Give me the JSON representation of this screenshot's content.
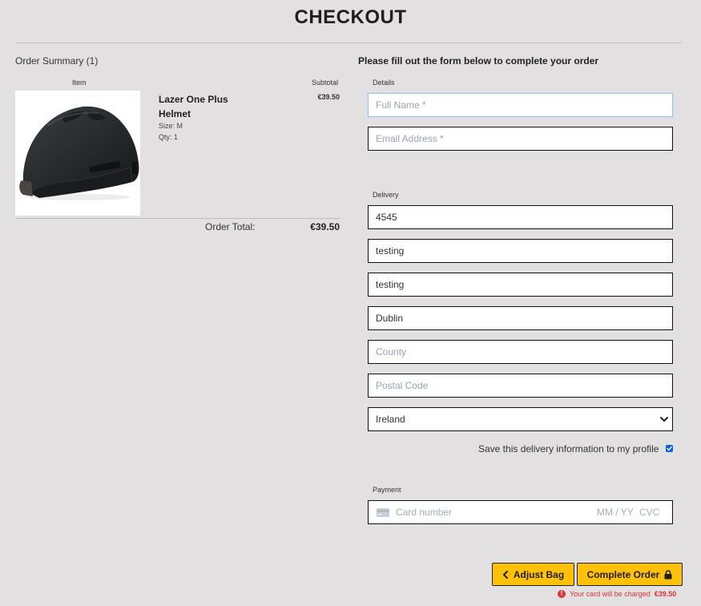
{
  "page": {
    "title": "CHECKOUT"
  },
  "summary": {
    "heading": "Order Summary (1)",
    "col_item": "Item",
    "col_subtotal": "Subtotal",
    "product": {
      "name": "Lazer One Plus Helmet",
      "size": "Size: M",
      "qty": "Qty: 1",
      "subtotal": "€39.50"
    },
    "total_label": "Order Total:",
    "total_value": "€39.50"
  },
  "form": {
    "heading": "Please fill out the form below to complete your order",
    "details_legend": "Details",
    "full_name_placeholder": "Full Name *",
    "email_placeholder": "Email Address *",
    "delivery_legend": "Delivery",
    "phone_value": "4545",
    "street1_value": "testing",
    "street2_value": "testing",
    "town_value": "Dublin",
    "county_placeholder": "County",
    "postcode_placeholder": "Postal Code",
    "country_selected": "Ireland",
    "save_info_label": "Save this delivery information to my profile",
    "save_info_checked": true,
    "payment_legend": "Payment",
    "card_number_placeholder": "Card number",
    "card_expiry_placeholder": "MM / YY",
    "card_cvc_placeholder": "CVC"
  },
  "buttons": {
    "adjust_bag": "Adjust Bag",
    "complete_order": "Complete Order"
  },
  "charge_notice": {
    "text": "Your card will be charged",
    "amount": "€39.50"
  },
  "colors": {
    "page_bg": "#e2e0e0",
    "button_accent": "#ffc107",
    "notice_red": "#d9343c",
    "checkbox_blue": "#0b63e5"
  },
  "icons": {
    "adjust_bag": "chevron-left-icon",
    "complete_order": "lock-icon",
    "card": "credit-card-icon",
    "notice": "exclamation-circle-icon",
    "select": "chevron-down-icon"
  }
}
